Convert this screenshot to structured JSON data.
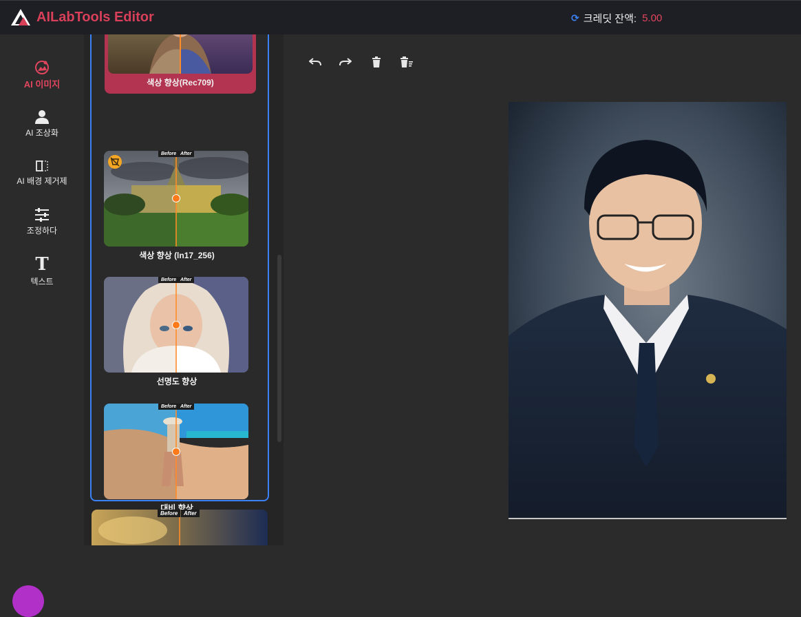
{
  "app": {
    "title": "AILabTools Editor"
  },
  "credits": {
    "label": "크레딧 잔액:",
    "value": "5.00"
  },
  "sidebar": {
    "items": [
      {
        "label": "AI 이미지",
        "icon": "ai-image-icon",
        "active": true
      },
      {
        "label": "AI 조상화",
        "icon": "portrait-user-icon",
        "active": false
      },
      {
        "label": "AI 배경 제거제",
        "icon": "background-remove-icon",
        "active": false
      },
      {
        "label": "조정하다",
        "icon": "sliders-icon",
        "active": false
      },
      {
        "label": "텍스트",
        "icon": "text-T-icon",
        "active": false
      }
    ]
  },
  "effects": {
    "before_label": "Before",
    "after_label": "After",
    "cards": [
      {
        "label": "색상 향상(Rec709)",
        "selected": true
      },
      {
        "label": "색상 향상 (ln17_256)",
        "selected": false
      },
      {
        "label": "선명도 향상",
        "selected": false
      },
      {
        "label": "대비 향상",
        "selected": false
      }
    ]
  },
  "toolbar": {
    "buttons": [
      {
        "icon": "undo-icon"
      },
      {
        "icon": "redo-icon"
      },
      {
        "icon": "delete-icon"
      },
      {
        "icon": "clear-all-icon"
      }
    ]
  },
  "colors": {
    "accent": "#d8405a",
    "selection_border": "#3b82f6",
    "active_card": "#b23450"
  }
}
